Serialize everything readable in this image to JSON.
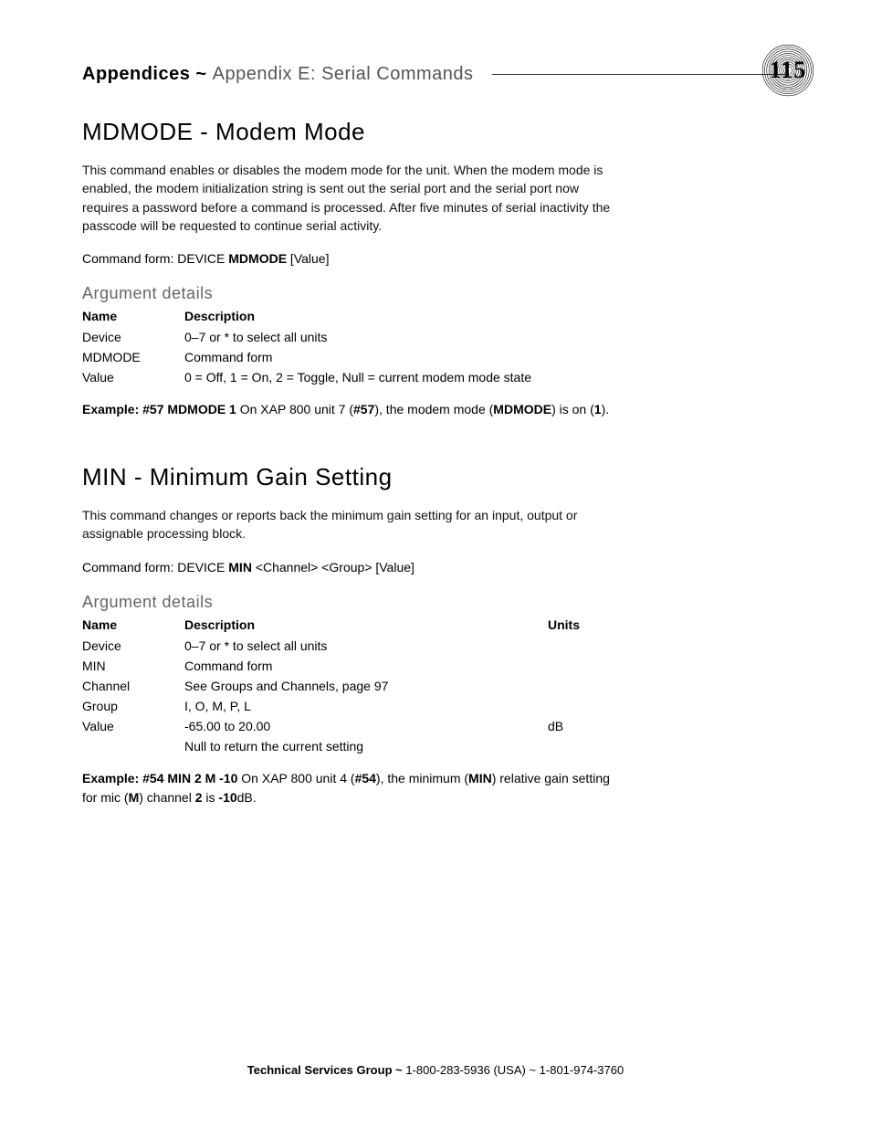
{
  "header": {
    "bold": "Appendices ~ ",
    "light": "Appendix E: Serial Commands",
    "page_number": "115"
  },
  "sections": [
    {
      "title": "MDMODE - Modem Mode",
      "body": "This command enables or disables the modem mode for the unit. When the modem mode is enabled, the modem initialization string is sent out the serial port and the serial port now requires a password before a command is processed. After five minutes of serial inactivity the passcode will be requested to continue serial activity.",
      "command_form": {
        "label": "Command form: DEVICE ",
        "bold": "MDMODE",
        "rest": " [Value]"
      },
      "arg_heading": "Argument details",
      "arg_headers": {
        "name": "Name",
        "desc": "Description",
        "units": ""
      },
      "args": [
        {
          "name": "Device",
          "desc": "0–7 or * to select all units",
          "units": ""
        },
        {
          "name": "MDMODE",
          "desc": "Command form",
          "units": ""
        },
        {
          "name": "Value",
          "desc": "0 = Off, 1 = On, 2 = Toggle, Null = current modem mode state",
          "units": ""
        }
      ],
      "example": {
        "pre_bold": "Example: #57 MDMODE 1",
        "p1": "  On XAP 800 unit 7 (",
        "b1": "#57",
        "p2": "), the modem mode (",
        "b2": "MDMODE",
        "p3": ") is on (",
        "b3": "1",
        "p4": ")."
      }
    },
    {
      "title": "MIN - Minimum Gain Setting",
      "body": "This command changes or reports back the minimum gain setting for an input, output or assignable processing block.",
      "command_form": {
        "label": "Command form: DEVICE ",
        "bold": "MIN",
        "rest": " <Channel> <Group> [Value]"
      },
      "arg_heading": "Argument details",
      "arg_headers": {
        "name": "Name",
        "desc": "Description",
        "units": "Units"
      },
      "args": [
        {
          "name": "Device",
          "desc": "0–7 or * to select all units",
          "units": ""
        },
        {
          "name": "MIN",
          "desc": "Command form",
          "units": ""
        },
        {
          "name": "Channel",
          "desc": "See Groups and Channels, page 97",
          "units": ""
        },
        {
          "name": "Group",
          "desc": "I, O, M, P, L",
          "units": ""
        },
        {
          "name": "Value",
          "desc": "-65.00 to 20.00",
          "units": "dB"
        },
        {
          "name": "",
          "desc": "Null to return the current setting",
          "units": ""
        }
      ],
      "example": {
        "pre_bold": "Example: #54 MIN 2 M -10",
        "p1": "  On XAP 800 unit 4 (",
        "b1": "#54",
        "p2": "), the minimum (",
        "b2": "MIN",
        "p3": ") relative gain setting for mic (",
        "b3": "M",
        "p4": ") channel ",
        "b4": "2",
        "p5": " is ",
        "b5": "-10",
        "p6": "dB."
      }
    }
  ],
  "footer": {
    "bold": "Technical Services Group ~ ",
    "rest": "1-800-283-5936 (USA) ~ 1-801-974-3760"
  }
}
